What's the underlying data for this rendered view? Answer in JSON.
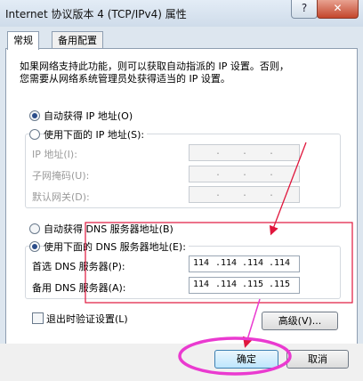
{
  "window": {
    "title": "Internet 协议版本 4 (TCP/IPv4) 属性",
    "help_label": "?",
    "close_label": "✕"
  },
  "tabs": [
    {
      "label": "常规"
    },
    {
      "label": "备用配置"
    }
  ],
  "description": {
    "line1": "如果网络支持此功能，则可以获取自动指派的 IP 设置。否则，",
    "line2": "您需要从网络系统管理员处获得适当的 IP 设置。"
  },
  "ip_section": {
    "auto_label": "自动获得 IP 地址(O)",
    "manual_label": "使用下面的 IP 地址(S):",
    "fields": [
      {
        "label": "IP 地址(I):"
      },
      {
        "label": "子网掩码(U):"
      },
      {
        "label": "默认网关(D):"
      }
    ],
    "dot": "."
  },
  "dns_section": {
    "auto_label": "自动获得 DNS 服务器地址(B)",
    "manual_label": "使用下面的 DNS 服务器地址(E):",
    "preferred": {
      "label": "首选 DNS 服务器(P):",
      "octets": [
        "114",
        "114",
        "114",
        "114"
      ]
    },
    "alternate": {
      "label": "备用 DNS 服务器(A):",
      "octets": [
        "114",
        "114",
        "115",
        "115"
      ]
    }
  },
  "validate_label": "退出时验证设置(L)",
  "advanced_label": "高级(V)...",
  "ok_label": "确定",
  "cancel_label": "取消",
  "colors": {
    "annotation": "#e0163c",
    "highlight": "#ea3ad0"
  }
}
